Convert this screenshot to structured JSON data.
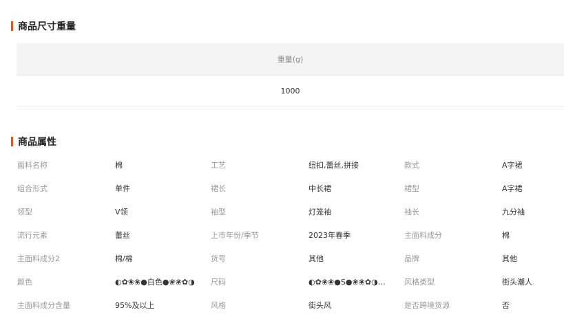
{
  "size_section": {
    "title": "商品尺寸重量",
    "header": "重量(g)",
    "value": "1000"
  },
  "attr_section": {
    "title": "商品属性",
    "rows": [
      [
        {
          "label": "面料名称",
          "value": "棉"
        },
        {
          "label": "工艺",
          "value": "纽扣,蕾丝,拼接"
        },
        {
          "label": "款式",
          "value": "A字裙"
        }
      ],
      [
        {
          "label": "组合形式",
          "value": "单件"
        },
        {
          "label": "裙长",
          "value": "中长裙"
        },
        {
          "label": "裙型",
          "value": "A字裙"
        }
      ],
      [
        {
          "label": "领型",
          "value": "V领"
        },
        {
          "label": "袖型",
          "value": "灯笼袖"
        },
        {
          "label": "袖长",
          "value": "九分袖"
        }
      ],
      [
        {
          "label": "流行元素",
          "value": "蕾丝"
        },
        {
          "label": "上市年份/季节",
          "value": "2023年春季"
        },
        {
          "label": "主面料成分",
          "value": "棉"
        }
      ],
      [
        {
          "label": "主面料成分2",
          "value": "棉/棉"
        },
        {
          "label": "货号",
          "value": "其他"
        },
        {
          "label": "品牌",
          "value": "其他"
        }
      ],
      [
        {
          "label": "颜色",
          "value": "◐✿❀❀●白色●❀❀✿◑"
        },
        {
          "label": "尺码",
          "value": "◐✿❀❀●S●❀❀✿◑,…"
        },
        {
          "label": "风格类型",
          "value": "街头潮人"
        }
      ],
      [
        {
          "label": "主面料成分含量",
          "value": "95%及以上"
        },
        {
          "label": "风格",
          "value": "街头风"
        },
        {
          "label": "是否跨境货源",
          "value": "否"
        }
      ]
    ]
  }
}
